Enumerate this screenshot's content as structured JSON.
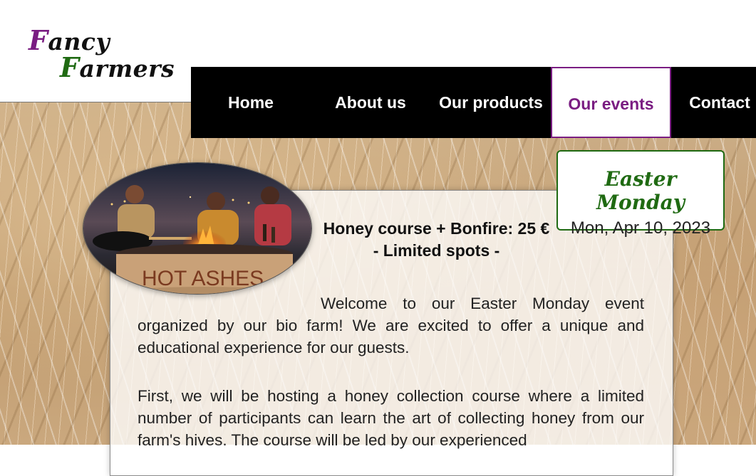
{
  "logo": {
    "line1_initial": "F",
    "line1_rest": "ancy",
    "line2_initial": "F",
    "line2_rest": "armers",
    "colors": {
      "primary": "#7a1d82",
      "secondary": "#1f6a12"
    }
  },
  "nav": {
    "items": [
      {
        "label": "Home"
      },
      {
        "label": "About us"
      },
      {
        "label": "Our products"
      },
      {
        "label": "Our events"
      },
      {
        "label": "Contact"
      }
    ],
    "active": "Our events"
  },
  "event": {
    "title": "Easter Monday",
    "date": "Mon, Apr 10, 2023"
  },
  "offer": {
    "line1": "Honey course + Bonfire: 25 €",
    "line2": "- Limited spots -"
  },
  "content": {
    "paragraph1": "Welcome to our Easter Monday event organized by our bio farm! We are excited to offer a unique and educational experience for our guests.",
    "paragraph2": "First, we will be hosting a honey collection course where a limited number of participants can learn the art of collecting honey from our farm's hives. The course will be led by our experienced"
  },
  "photo": {
    "sign_text": "HOT ASHES"
  }
}
